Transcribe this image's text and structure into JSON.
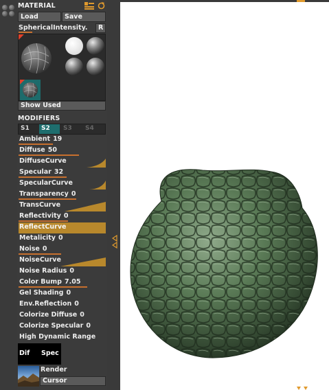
{
  "material": {
    "title": "MATERIAL",
    "load_label": "Load",
    "save_label": "Save",
    "current_name": "SphericalIntensity.",
    "r_label": "R",
    "show_used_label": "Show Used"
  },
  "modifiers": {
    "title": "MODIFIERS",
    "tabs": [
      "S1",
      "S2",
      "S3",
      "S4"
    ],
    "active_tab": "S2",
    "ambient": {
      "label": "Ambient",
      "value": "19"
    },
    "diffuse": {
      "label": "Diffuse",
      "value": "50"
    },
    "diffuse_curve": {
      "label": "DiffuseCurve"
    },
    "specular": {
      "label": "Specular",
      "value": "32"
    },
    "specular_curve": {
      "label": "SpecularCurve"
    },
    "transparency": {
      "label": "Transparency",
      "value": "0"
    },
    "trans_curve": {
      "label": "TransCurve"
    },
    "reflectivity": {
      "label": "Reflectivity",
      "value": "0"
    },
    "reflect_curve": {
      "label": "ReflectCurve"
    },
    "metalicity": {
      "label": "Metalicity",
      "value": "0"
    },
    "noise": {
      "label": "Noise",
      "value": "0"
    },
    "noise_curve": {
      "label": "NoiseCurve"
    },
    "noise_radius": {
      "label": "Noise Radius",
      "value": "0"
    },
    "color_bump": {
      "label": "Color Bump",
      "value": "7.05"
    },
    "gel_shading": {
      "label": "Gel Shading",
      "value": "0"
    },
    "env_reflection": {
      "label": "Env.Reflection",
      "value": "0"
    },
    "colorize_diffuse": {
      "label": "Colorize Diffuse",
      "value": "0"
    },
    "colorize_specular": {
      "label": "Colorize Specular",
      "value": "0"
    },
    "hdr": {
      "label": "High Dynamic Range"
    },
    "dif_label": "Dif",
    "spec_label": "Spec"
  },
  "render": {
    "render_label": "Render",
    "cursor_label": "Cursor"
  },
  "colors": {
    "accent_orange": "#c8702e",
    "curve_gold": "#b8882c",
    "active_tab": "#1e6e6e",
    "model_green": "#4e6b4c"
  }
}
